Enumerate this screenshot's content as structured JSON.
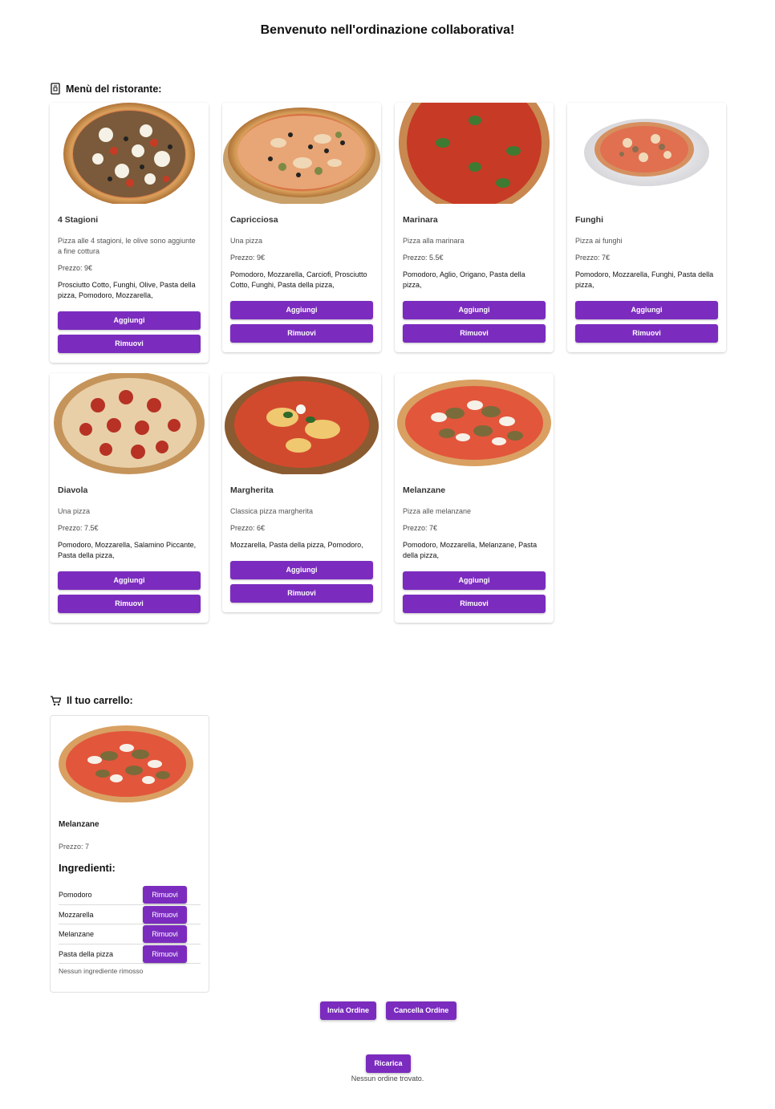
{
  "page": {
    "title": "Benvenuto nell'ordinazione collaborativa!"
  },
  "menu": {
    "title": "Menù del ristorante:",
    "icon": "menu-book-icon",
    "add_label": "Aggiungi",
    "remove_label": "Rimuovi",
    "items": [
      {
        "name": "4 Stagioni",
        "description": "Pizza alle 4 stagioni, le olive sono aggiunte a fine cottura",
        "price": "Prezzo: 9€",
        "ingredients": "Prosciutto Cotto, Funghi, Olive, Pasta della pizza, Pomodoro, Mozzarella,"
      },
      {
        "name": "Capricciosa",
        "description": "Una pizza",
        "price": "Prezzo: 9€",
        "ingredients": "Pomodoro, Mozzarella, Carciofi, Prosciutto Cotto, Funghi, Pasta della pizza,"
      },
      {
        "name": "Marinara",
        "description": "Pizza alla marinara",
        "price": "Prezzo: 5.5€",
        "ingredients": "Pomodoro, Aglio, Origano, Pasta della pizza,"
      },
      {
        "name": "Funghi",
        "description": "Pizza ai funghi",
        "price": "Prezzo: 7€",
        "ingredients": "Pomodoro, Mozzarella, Funghi, Pasta della pizza,"
      },
      {
        "name": "Diavola",
        "description": "Una pizza",
        "price": "Prezzo: 7.5€",
        "ingredients": "Pomodoro, Mozzarella, Salamino Piccante, Pasta della pizza,"
      },
      {
        "name": "Margherita",
        "description": "Classica pizza margherita",
        "price": "Prezzo: 6€",
        "ingredients": "Mozzarella, Pasta della pizza, Pomodoro,"
      },
      {
        "name": "Melanzane",
        "description": "Pizza alle melanzane",
        "price": "Prezzo: 7€",
        "ingredients": "Pomodoro, Mozzarella, Melanzane, Pasta della pizza,"
      }
    ]
  },
  "cart": {
    "title": "Il tuo carrello:",
    "icon": "shopping-cart-icon",
    "item": {
      "name": "Melanzane",
      "price": "Prezzo: 7",
      "ingredients_title": "Ingredienti:",
      "ingredients": [
        "Pomodoro",
        "Mozzarella",
        "Melanzane",
        "Pasta della pizza"
      ],
      "remove_label": "Rimuovi",
      "removed_note": "Nessun ingrediente rimosso"
    }
  },
  "actions": {
    "send": "Invia Ordine",
    "cancel": "Cancella Ordine",
    "reload": "Ricarica"
  },
  "status": "Nessun ordine trovato.",
  "colors": {
    "accent": "#7b2cbf"
  }
}
